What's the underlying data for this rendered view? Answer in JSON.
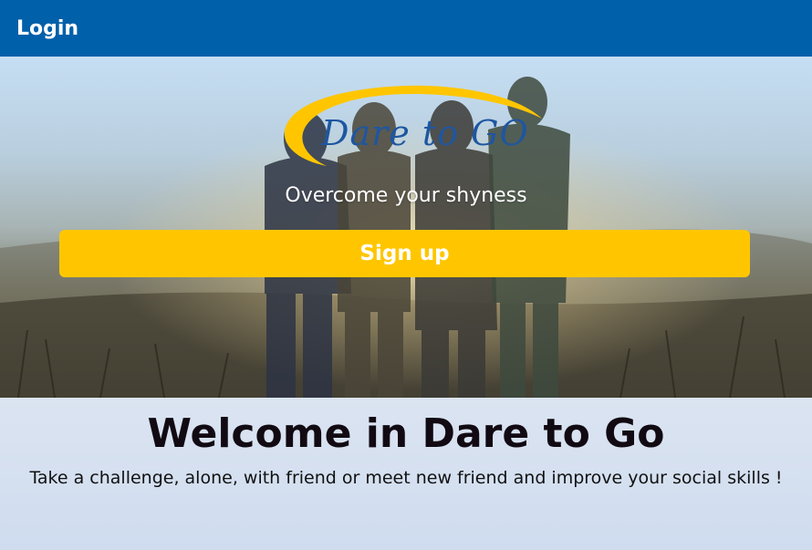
{
  "header": {
    "login_label": "Login",
    "background_color": "#0060a9"
  },
  "hero": {
    "logo_text": "Dare to GO",
    "tagline": "Overcome your shyness",
    "signup_label": "Sign up",
    "accent_color": "#ffc600"
  },
  "welcome": {
    "title": "Welcome in Dare to Go",
    "subtitle": "Take a challenge, alone, with friend or meet new friend and improve your social skills !"
  }
}
